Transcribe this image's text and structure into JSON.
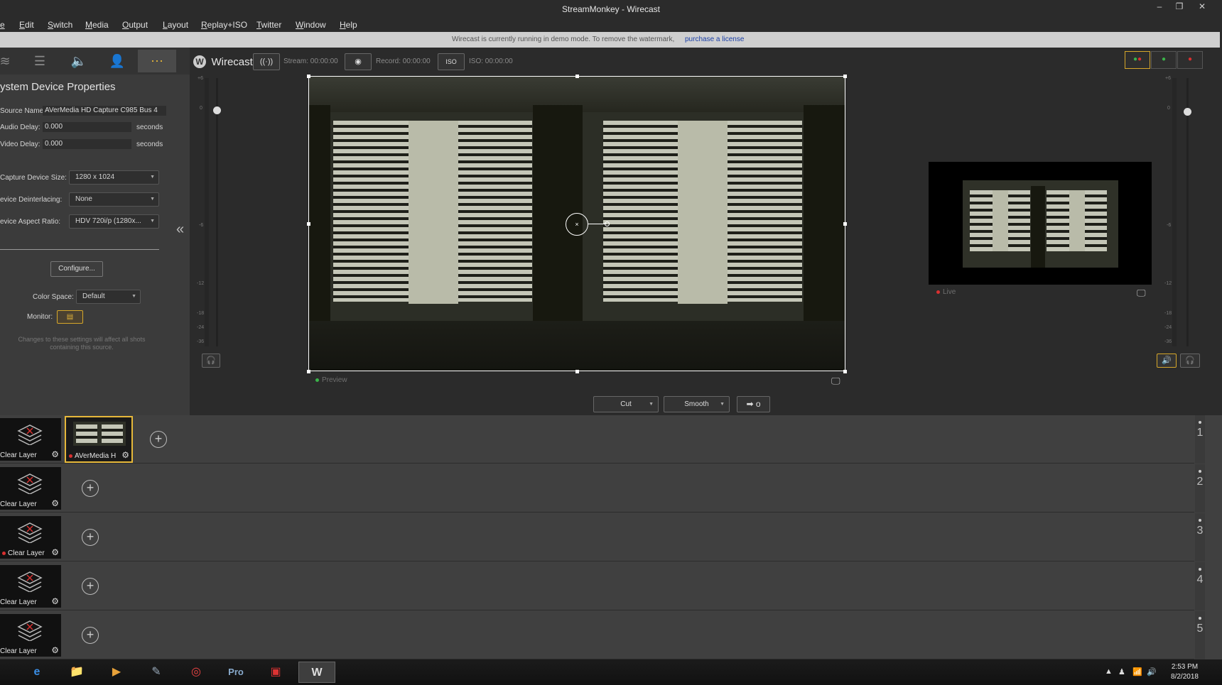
{
  "window": {
    "title": "StreamMonkey - Wirecast",
    "minimize": "–",
    "restore": "❐",
    "close": "✕"
  },
  "menu": [
    "e",
    "Edit",
    "Switch",
    "Media",
    "Output",
    "Layout",
    "Replay+ISO",
    "Twitter",
    "Window",
    "Help"
  ],
  "banner": {
    "text": "Wirecast is currently running in demo mode. To remove the watermark,",
    "link": "purchase a license"
  },
  "left_panel": {
    "title": "ystem Device Properties",
    "source_name_label": "Source Name",
    "source_name_value": "AVerMedia HD Capture C985 Bus 4",
    "audio_delay_label": "Audio Delay:",
    "audio_delay_value": "0.000",
    "video_delay_label": "Video Delay:",
    "video_delay_value": "0.000",
    "seconds": "seconds",
    "capture_size_label": "Capture Device Size:",
    "capture_size_value": "1280 x 1024",
    "deinterlacing_label": "evice Deinterlacing:",
    "deinterlacing_value": "None",
    "aspect_label": "evice Aspect Ratio:",
    "aspect_value": "HDV 720i/p (1280x...",
    "configure": "Configure...",
    "color_space_label": "Color Space:",
    "color_space_value": "Default",
    "monitor_label": "Monitor:",
    "note": "Changes to these settings will affect all shots containing this source."
  },
  "toolbar": {
    "brand": "Wirecast",
    "stream": "Stream: 00:00:00",
    "record": "Record: 00:00:00",
    "iso_label": "ISO",
    "iso": "ISO: 00:00:00"
  },
  "meter_scale": [
    "+6",
    "0",
    "-6",
    "-12",
    "-18",
    "-24",
    "-36"
  ],
  "preview_label": "Preview",
  "live_label": "Live",
  "transition": {
    "cut": "Cut",
    "smooth": "Smooth",
    "go": "➡ o"
  },
  "layers": [
    {
      "number": "1",
      "shots": [
        {
          "label": "Clear Layer",
          "live": false
        },
        {
          "label": "AVerMedia H",
          "live": true,
          "selected": true
        }
      ]
    },
    {
      "number": "2",
      "shots": [
        {
          "label": "Clear Layer",
          "live": false
        }
      ]
    },
    {
      "number": "3",
      "shots": [
        {
          "label": "Clear Layer",
          "live": true
        }
      ]
    },
    {
      "number": "4",
      "shots": [
        {
          "label": "Clear Layer",
          "live": false
        }
      ]
    },
    {
      "number": "5",
      "shots": [
        {
          "label": "Clear Layer",
          "live": false
        }
      ]
    }
  ],
  "taskbar": {
    "time": "2:53 PM",
    "date": "8/2/2018"
  },
  "colors": {
    "accent": "#e1b33a",
    "live_red": "#d93030",
    "preview_green": "#3bb44a"
  }
}
